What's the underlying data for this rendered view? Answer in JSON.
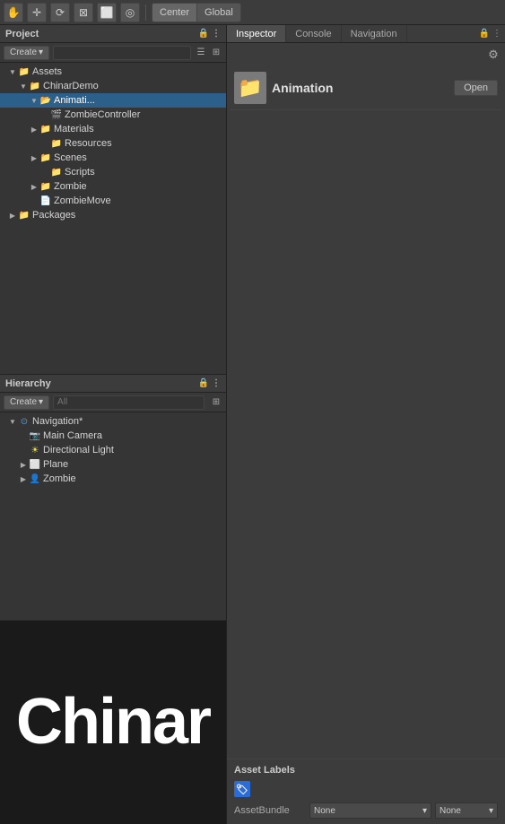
{
  "toolbar": {
    "buttons": [
      "☰",
      "✛",
      "⟳",
      "⊠",
      "⬜",
      "◎"
    ],
    "center_label": "Center",
    "global_label": "Global"
  },
  "project_panel": {
    "title": "Project",
    "create_label": "Create",
    "search_placeholder": "",
    "tree": [
      {
        "label": "Assets",
        "level": 0,
        "type": "folder",
        "open": true,
        "arrow": "▼"
      },
      {
        "label": "ChinarDemo",
        "level": 1,
        "type": "folder",
        "open": true,
        "arrow": "▼"
      },
      {
        "label": "Animati...",
        "level": 2,
        "type": "folder-open",
        "open": true,
        "arrow": "▼",
        "selected": true
      },
      {
        "label": "ZombieController",
        "level": 3,
        "type": "script",
        "open": false,
        "arrow": ""
      },
      {
        "label": "Materials",
        "level": 2,
        "type": "folder",
        "open": false,
        "arrow": "▶"
      },
      {
        "label": "Resources",
        "level": 2,
        "type": "folder",
        "open": false,
        "arrow": ""
      },
      {
        "label": "Scenes",
        "level": 2,
        "type": "folder",
        "open": false,
        "arrow": "▶"
      },
      {
        "label": "Scripts",
        "level": 2,
        "type": "folder",
        "open": false,
        "arrow": ""
      },
      {
        "label": "Zombie",
        "level": 2,
        "type": "folder",
        "open": false,
        "arrow": "▶"
      },
      {
        "label": "ZombieMove",
        "level": 2,
        "type": "script",
        "open": false,
        "arrow": ""
      },
      {
        "label": "Packages",
        "level": 0,
        "type": "folder",
        "open": false,
        "arrow": "▶"
      }
    ]
  },
  "hierarchy_panel": {
    "title": "Hierarchy",
    "create_label": "Create",
    "search_placeholder": "All",
    "tree": [
      {
        "label": "Navigation*",
        "level": 0,
        "type": "scene",
        "open": true,
        "arrow": "▼"
      },
      {
        "label": "Main Camera",
        "level": 1,
        "type": "camera",
        "open": false,
        "arrow": ""
      },
      {
        "label": "Directional Light",
        "level": 1,
        "type": "light",
        "open": false,
        "arrow": ""
      },
      {
        "label": "Plane",
        "level": 1,
        "type": "object",
        "open": false,
        "arrow": "▶"
      },
      {
        "label": "Zombie",
        "level": 1,
        "type": "object",
        "open": false,
        "arrow": "▶"
      }
    ]
  },
  "tabs": {
    "inspector": "Inspector",
    "console": "Console",
    "navigation": "Navigation"
  },
  "inspector": {
    "folder_icon": "📁",
    "title": "Animation",
    "open_button": "Open",
    "gear_icon": "⚙"
  },
  "scene": {
    "text": "Chinar"
  },
  "asset_labels": {
    "title": "Asset Labels",
    "rows": [
      {
        "key": "AssetBundle",
        "dropdown1": "None",
        "dropdown2": "None"
      }
    ],
    "badge_icon": "🏷"
  }
}
